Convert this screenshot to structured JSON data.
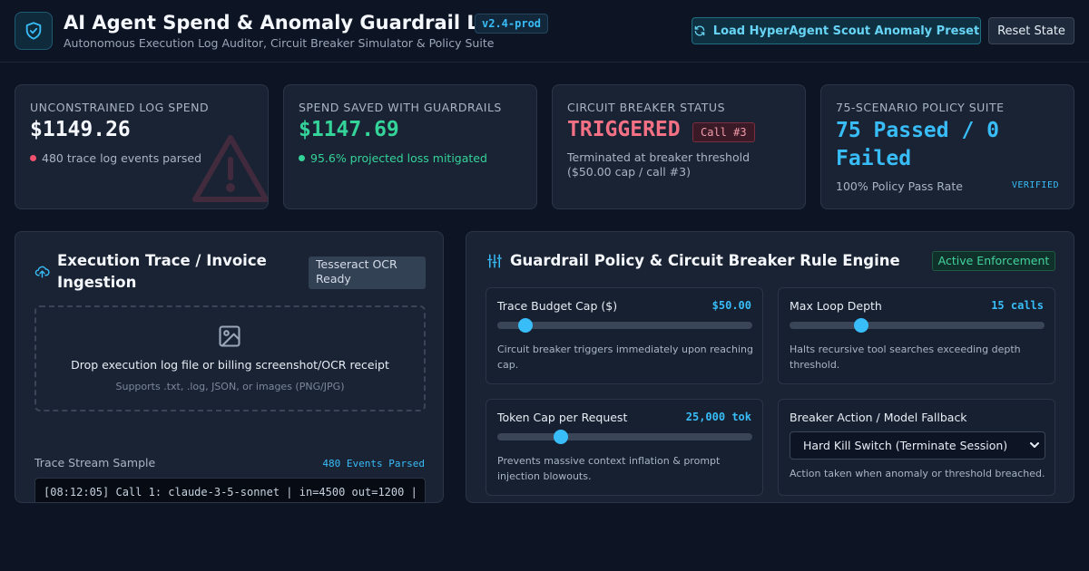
{
  "app": {
    "title": "AI Agent Spend & Anomaly Guardrail Lab",
    "version": "v2.4-prod",
    "subtitle": "Autonomous Execution Log Auditor, Circuit Breaker Simulator & Policy Suite"
  },
  "header": {
    "preset_button": "Load HyperAgent Scout Anomaly Preset",
    "reset_button": "Reset State",
    "icons": {
      "logo": "shield-check-icon",
      "preset": "refresh-icon"
    }
  },
  "cards": {
    "spend": {
      "label": "UNCONSTRAINED LOG SPEND",
      "value": "$1149.26",
      "sub": "480 trace log events parsed",
      "dot_color": "#f0506e",
      "icon": "warning-icon"
    },
    "saved": {
      "label": "SPEND SAVED WITH GUARDRAILS",
      "value": "$1147.69",
      "sub": "95.6% projected loss mitigated",
      "dot_color": "#34d399"
    },
    "breaker": {
      "label": "CIRCUIT BREAKER STATUS",
      "value": "TRIGGERED",
      "badge": "Call #3",
      "desc": "Terminated at breaker threshold ($50.00 cap / call #3)"
    },
    "policy": {
      "label": "75-SCENARIO POLICY SUITE",
      "value_line1": "75 Passed / 0",
      "value_line2": "Failed",
      "sub": "100% Policy Pass Rate",
      "badge": "VERIFIED"
    }
  },
  "ingestion": {
    "title_line1": "Execution Trace / Invoice",
    "title_line2": "Ingestion",
    "ocr_badge": "Tesseract OCR Ready",
    "dropzone_main": "Drop execution log file or billing screenshot/OCR receipt",
    "dropzone_sub": "Supports .txt, .log, JSON, or images (PNG/JPG)",
    "trace_label": "Trace Stream Sample",
    "trace_count": "480 Events Parsed",
    "trace_line": "[08:12:05] Call 1: claude-3-5-sonnet | in=4500 out=1200 |",
    "icons": {
      "title": "cloud-upload-icon",
      "dropzone": "image-icon"
    }
  },
  "rules": {
    "title": "Guardrail Policy & Circuit Breaker Rule Engine",
    "status": "Active Enforcement",
    "icon": "sliders-icon",
    "budget": {
      "label": "Trace Budget Cap ($)",
      "value": "$50.00",
      "level": 0.11,
      "desc": "Circuit breaker triggers immediately upon reaching cap."
    },
    "loop": {
      "label": "Max Loop Depth",
      "value": "15 calls",
      "level": 0.28,
      "desc": "Halts recursive tool searches exceeding depth threshold."
    },
    "tokens": {
      "label": "Token Cap per Request",
      "value": "25,000 tok",
      "level": 0.25,
      "desc": "Prevents massive context inflation & prompt injection blowouts."
    },
    "action": {
      "label": "Breaker Action / Model Fallback",
      "selected": "Hard Kill Switch (Terminate Session)",
      "desc": "Action taken when anomaly or threshold breached."
    }
  },
  "colors": {
    "accent": "#38bdf8",
    "danger": "#f47185",
    "success": "#34d399",
    "background": "#0d1424",
    "card": "#1a2333"
  }
}
